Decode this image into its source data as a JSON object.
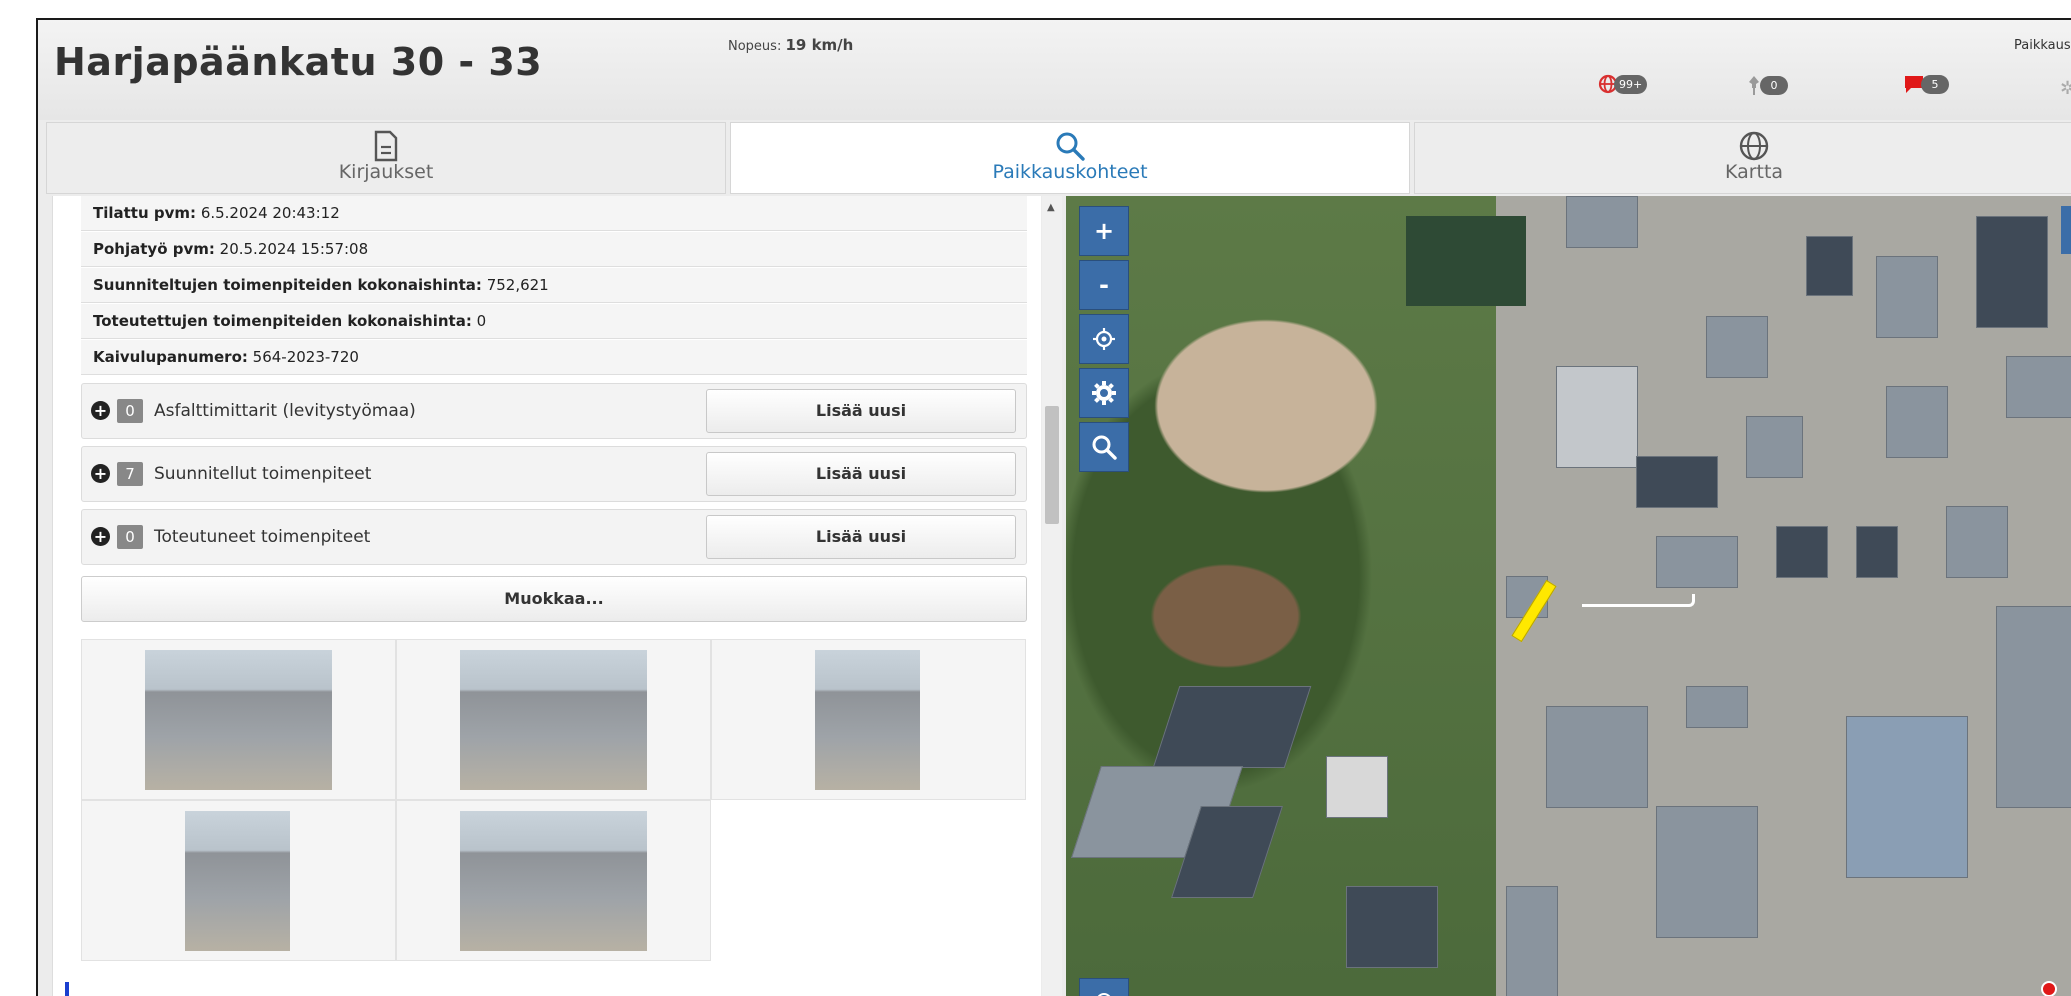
{
  "header": {
    "title": "Harjapäänkatu 30 - 33",
    "speed_label": "Nopeus:",
    "speed_value": "19 km/h",
    "right_text": "Paikkaus",
    "badges": [
      {
        "icon": "globe-icon",
        "count": "99+",
        "color": "#d93030"
      },
      {
        "icon": "pin-icon",
        "count": "0",
        "color": "#9a9a9a"
      },
      {
        "icon": "chat-icon",
        "count": "5",
        "color": "#e01818"
      }
    ]
  },
  "tabs": [
    {
      "label": "Kirjaukset",
      "icon": "document-icon",
      "active": false
    },
    {
      "label": "Paikkauskohteet",
      "icon": "search-icon",
      "active": true
    },
    {
      "label": "Kartta",
      "icon": "globe-icon",
      "active": false
    }
  ],
  "details": [
    {
      "label": "Tilattu pvm:",
      "value": "6.5.2024 20:43:12"
    },
    {
      "label": "Pohjatyö pvm:",
      "value": "20.5.2024 15:57:08"
    },
    {
      "label": "Suunniteltujen toimenpiteiden kokonaishinta:",
      "value": "752,621"
    },
    {
      "label": "Toteutettujen toimenpiteiden kokonaishinta:",
      "value": "0"
    },
    {
      "label": "Kaivulupanumero:",
      "value": "564-2023-720"
    }
  ],
  "sections": [
    {
      "count": "0",
      "name": "Asfalttimittarit (levitystyömaa)",
      "button": "Lisää uusi"
    },
    {
      "count": "7",
      "name": "Suunnitellut toimenpiteet",
      "button": "Lisää uusi"
    },
    {
      "count": "0",
      "name": "Toteutuneet toimenpiteet",
      "button": "Lisää uusi"
    }
  ],
  "edit_button": "Muokkaa...",
  "map": {
    "controls": [
      {
        "icon": "plus-icon",
        "glyph": "+"
      },
      {
        "icon": "minus-icon",
        "glyph": "-"
      },
      {
        "icon": "locate-icon",
        "glyph": "⊙"
      },
      {
        "icon": "gear-icon",
        "glyph": "⚙"
      },
      {
        "icon": "search-icon",
        "glyph": "🔍"
      }
    ]
  }
}
